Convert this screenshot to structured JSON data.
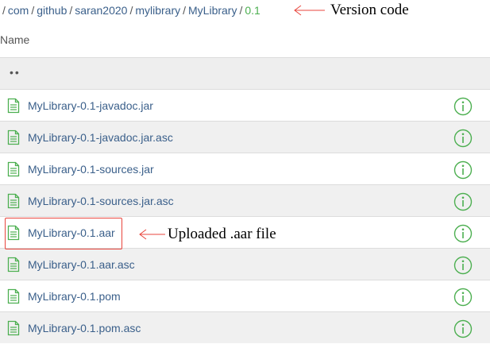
{
  "breadcrumb": {
    "items": [
      "com",
      "github",
      "saran2020",
      "mylibrary",
      "MyLibrary"
    ],
    "current": "0.1"
  },
  "annotations": {
    "version": "Version  code",
    "upload": "Uploaded  .aar  file"
  },
  "table": {
    "header": "Name",
    "parent_label": "••",
    "files": [
      {
        "name": "MyLibrary-0.1-javadoc.jar"
      },
      {
        "name": "MyLibrary-0.1-javadoc.jar.asc"
      },
      {
        "name": "MyLibrary-0.1-sources.jar"
      },
      {
        "name": "MyLibrary-0.1-sources.jar.asc"
      },
      {
        "name": "MyLibrary-0.1.aar"
      },
      {
        "name": "MyLibrary-0.1.aar.asc"
      },
      {
        "name": "MyLibrary-0.1.pom"
      },
      {
        "name": "MyLibrary-0.1.pom.asc"
      }
    ]
  },
  "colors": {
    "link": "#3a5f8a",
    "current": "#4caf50",
    "icon_green": "#4caf50",
    "annotation_red": "#e8453c"
  },
  "icons": {
    "file": "file-icon",
    "info": "info-icon",
    "arrow": "arrow-left-icon"
  }
}
